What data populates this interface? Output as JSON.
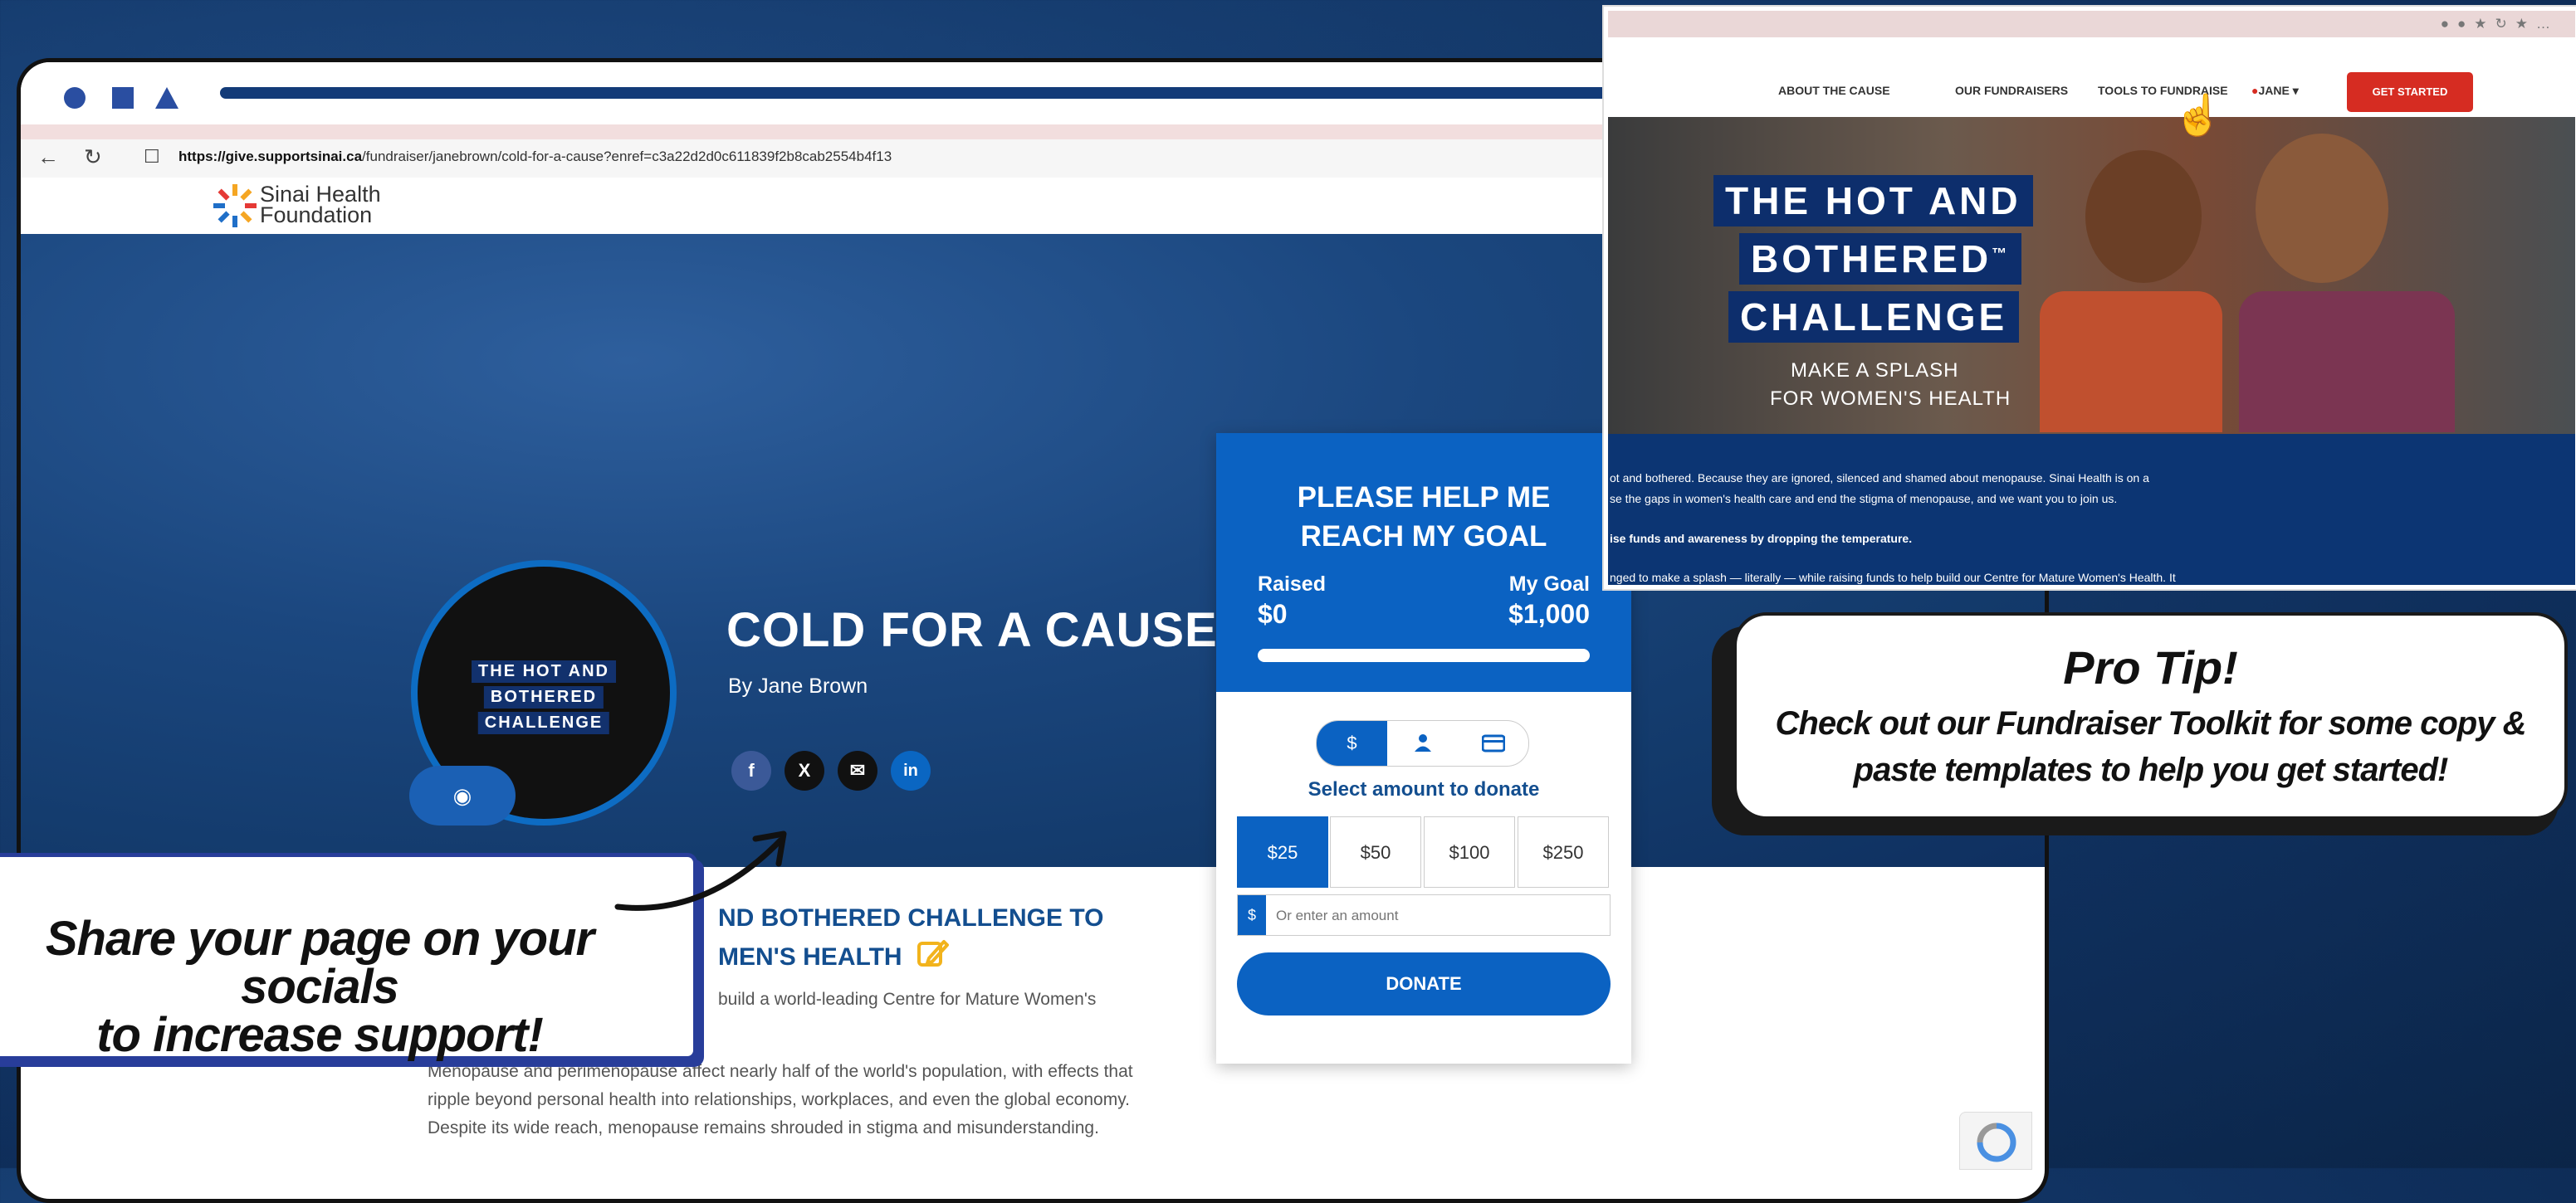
{
  "browser": {
    "url_domain": "https://give.supportsinai.ca",
    "url_path": "/fundraiser/janebrown/cold-for-a-cause?enref=c3a22d2d0c611839f2b8cab2554b4f13"
  },
  "site": {
    "logo_line1": "Sinai Health",
    "logo_line2": "Foundation"
  },
  "fundraiser": {
    "badge_line1": "THE HOT AND",
    "badge_line2": "BOTHERED",
    "badge_line3": "CHALLENGE",
    "title": "COLD FOR A CAUSE",
    "byline": "By Jane Brown",
    "story_title_line1": "ND BOTHERED CHALLENGE TO",
    "story_title_line2": "MEN'S HEALTH",
    "story_intro": "build a world-leading Centre for Mature Women's",
    "story_body": "Menopause and perimenopause affect nearly half of the world's population, with effects that ripple beyond personal health into relationships, workplaces, and even the global economy. Despite its wide reach, menopause remains shrouded in stigma and misunderstanding."
  },
  "donation": {
    "heading_line1": "PLEASE HELP ME",
    "heading_line2": "REACH MY GOAL",
    "raised_label": "Raised",
    "raised_value": "$0",
    "goal_label": "My Goal",
    "goal_value": "$1,000",
    "progress_fraction": 0,
    "tab_dollar": "$",
    "select_label": "Select amount to donate",
    "amounts": [
      "$25",
      "$50",
      "$100",
      "$250"
    ],
    "selected_amount": "$25",
    "input_prefix": "$",
    "input_placeholder": "Or enter an amount",
    "donate_label": "DONATE"
  },
  "callouts": {
    "share_line1": "Share your page on your socials",
    "share_line2": "to increase support!",
    "protip_title": "Pro Tip!",
    "protip_line1": "Check out our Fundraiser Toolkit for some copy &",
    "protip_line2": "paste templates to help you get started!"
  },
  "inset": {
    "nav": [
      "ABOUT THE CAUSE",
      "OUR FUNDRAISERS",
      "TOOLS TO FUNDRAISE",
      "JANE"
    ],
    "cta": "GET STARTED",
    "hero_line1": "THE HOT AND",
    "hero_line2": "BOTHERED",
    "hero_tm": "™",
    "hero_line3": "CHALLENGE",
    "hero_sub1": "MAKE A SPLASH",
    "hero_sub2": "FOR WOMEN'S HEALTH",
    "para1": "ot and bothered. Because they are ignored, silenced and shamed about menopause. Sinai Health is on a",
    "para2": "se the gaps in women's health care and end the stigma of menopause, and we want you to join us.",
    "para3": "ise funds and awareness by dropping the temperature.",
    "para4": "nged to make a splash — literally — while raising funds to help build our Centre for Mature Women's Health. It"
  },
  "colors": {
    "brand_blue": "#0b62c2",
    "navy": "#12316d",
    "cta_red": "#d62c22",
    "callout_border": "#283d9a"
  }
}
